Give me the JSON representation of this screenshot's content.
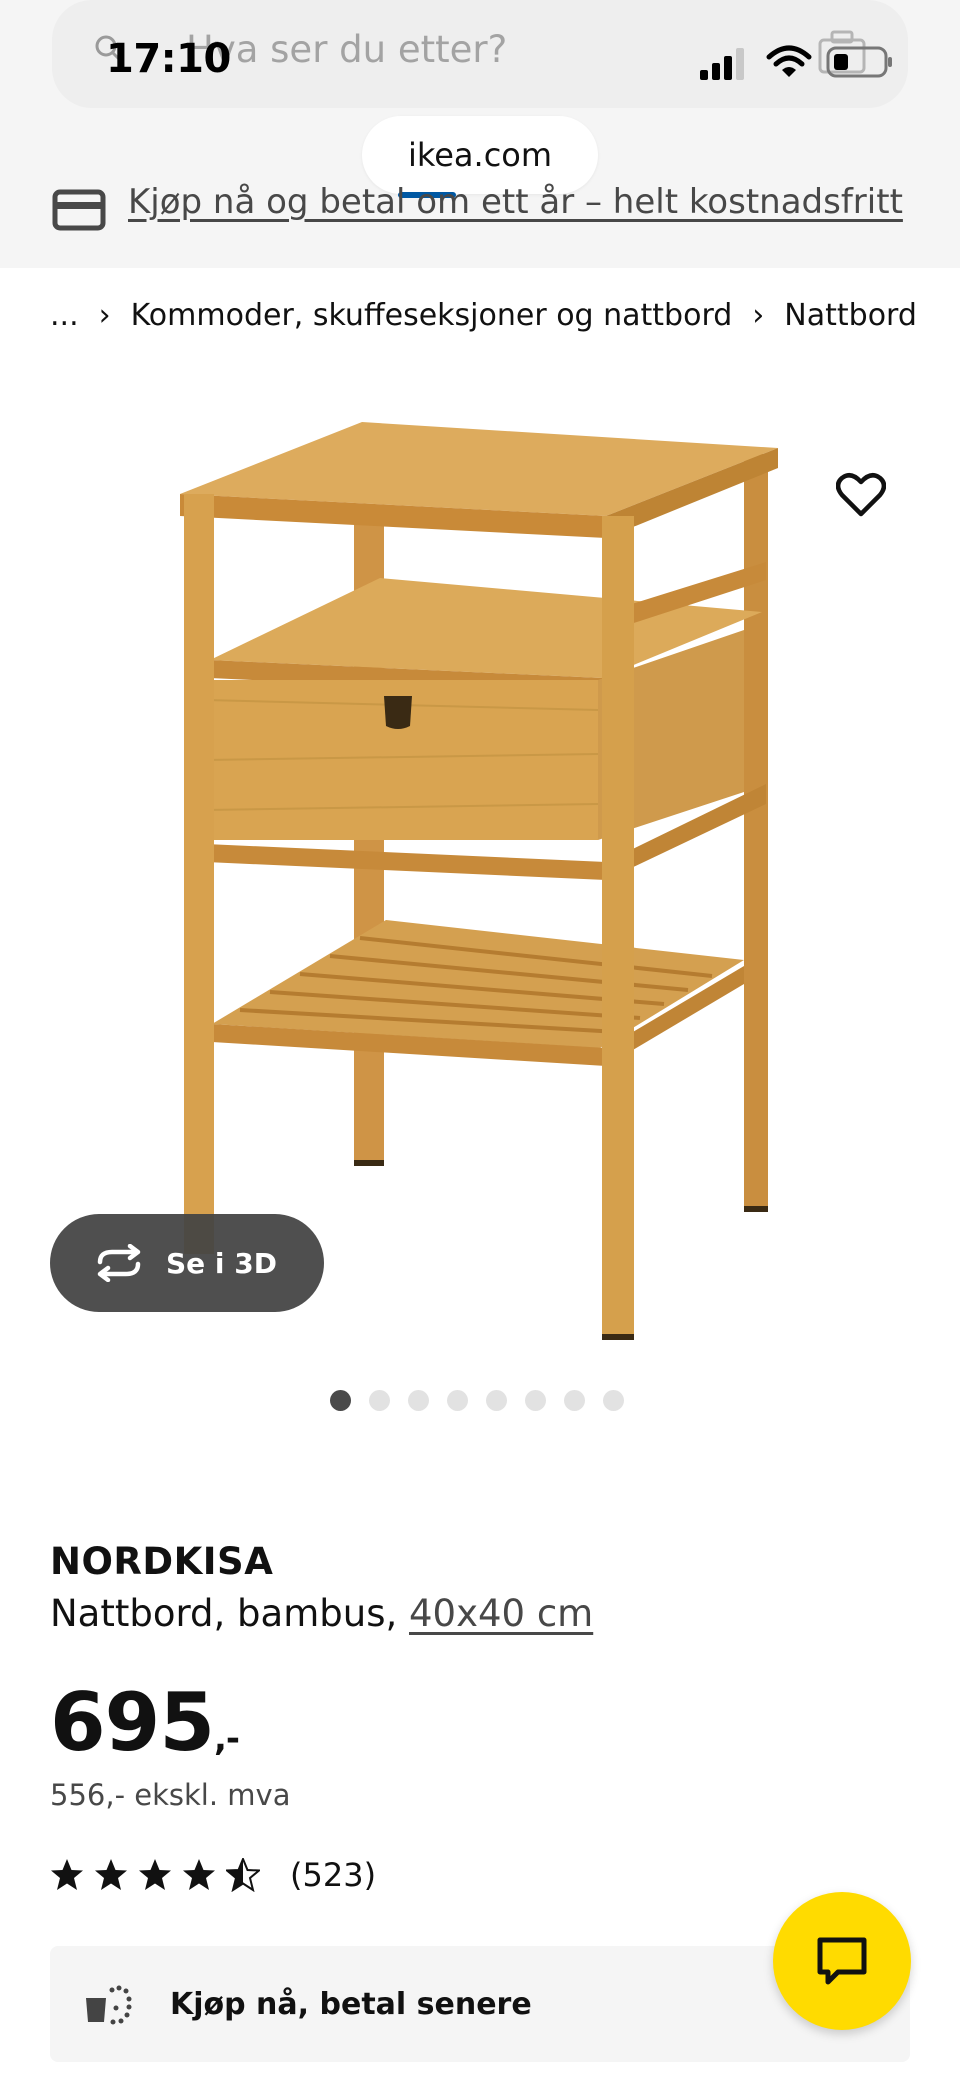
{
  "status_bar": {
    "time": "17:10"
  },
  "search": {
    "placeholder": "Hva ser du etter?"
  },
  "browser": {
    "url": "ikea.com"
  },
  "promo": {
    "text": "Kjøp nå og betal om ett år – helt kostnadsfritt"
  },
  "breadcrumb": {
    "items": [
      "...",
      "Kommoder, skuffeseksjoner og nattbord",
      "Nattbord"
    ]
  },
  "gallery": {
    "view_3d_label": "Se i 3D",
    "image_count": 8,
    "active_index": 0
  },
  "product": {
    "name": "NORDKISA",
    "description": "Nattbord, bambus, ",
    "size": "40x40 cm",
    "price": "695",
    "price_suffix": ",-",
    "price_ex_vat": "556,- ekskl. mva",
    "rating": 4.5,
    "review_count": "(523)"
  },
  "paylater": {
    "label": "Kjøp nå, betal senere"
  },
  "colors": {
    "chat_button": "#ffdb00",
    "load_bar": "#0058a3",
    "bamboo": "#d9a451"
  }
}
